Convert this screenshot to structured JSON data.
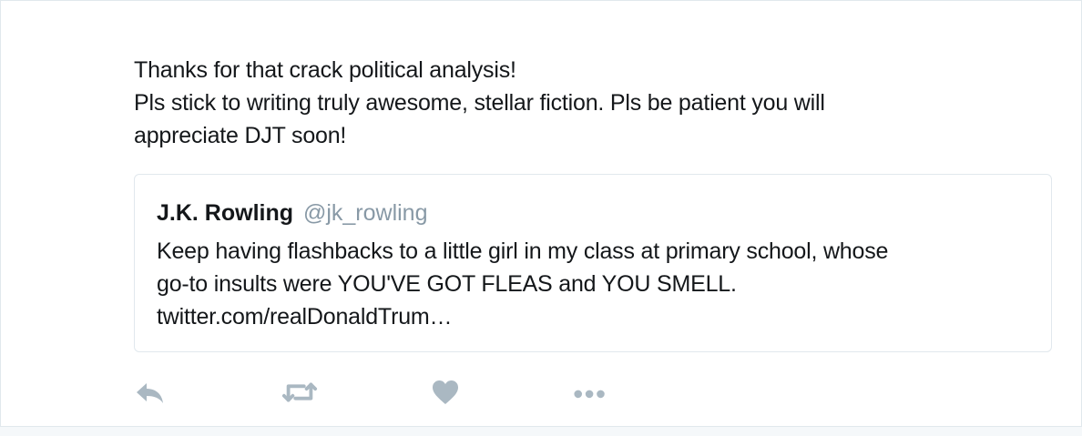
{
  "tweet": {
    "text_lines": [
      "Thanks for that crack political analysis!",
      "Pls stick to writing truly awesome, stellar fiction. Pls be patient you will",
      "appreciate DJT soon!"
    ]
  },
  "quoted_tweet": {
    "name": "J.K. Rowling",
    "handle": "@jk_rowling",
    "text_lines": [
      "Keep having flashbacks to a little girl in my class at primary school, whose",
      "go-to insults were YOU'VE GOT FLEAS and YOU SMELL.",
      "twitter.com/realDonaldTrum…"
    ]
  },
  "actions": {
    "icons": [
      "reply-icon",
      "retweet-icon",
      "like-icon",
      "more-icon"
    ]
  },
  "colors": {
    "text": "#14171a",
    "muted": "#8899a6",
    "icon": "#aab8c2",
    "border": "#e1e8ed"
  }
}
